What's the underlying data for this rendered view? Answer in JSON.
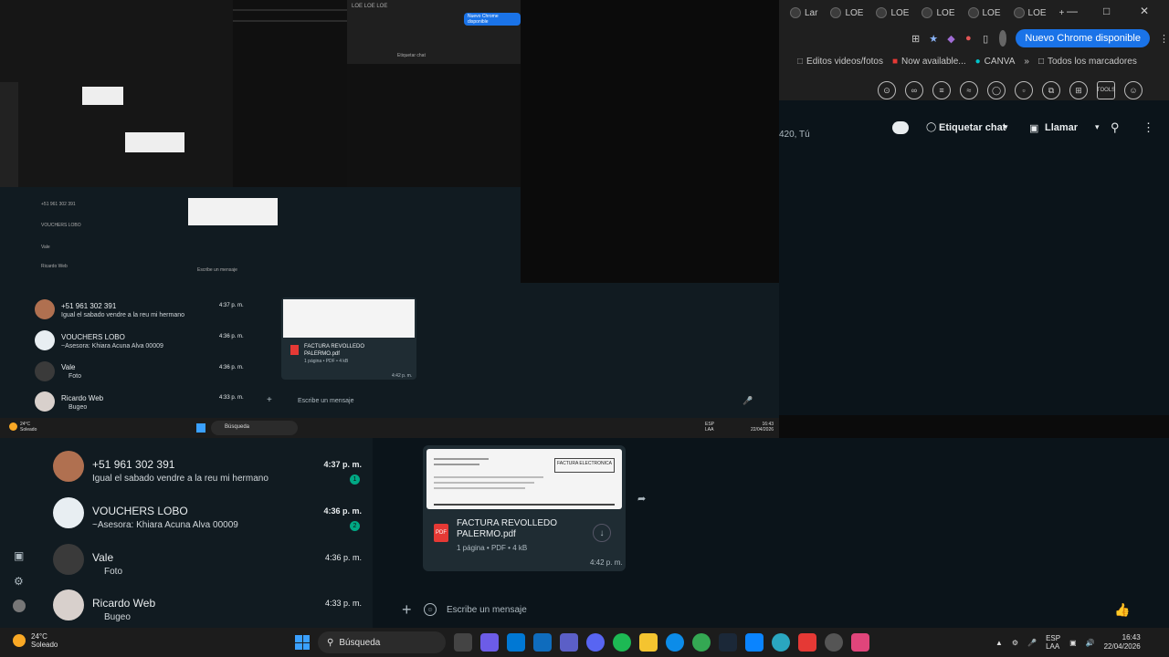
{
  "chrome": {
    "tabs": [
      "Lar",
      "LOE",
      "LOE",
      "LOE",
      "LOE",
      "LOE"
    ],
    "new_chrome_label": "Nuevo Chrome disponible",
    "bookmarks": [
      "Editos videos/fotos",
      "Now available...",
      "CANVA"
    ],
    "all_bookmarks": "Todos los marcadores",
    "ext_tools_label": "TOOLS"
  },
  "chat_header": {
    "tag_label": "Etiquetar chat",
    "call_label": "Llamar",
    "sub": "420, Tú"
  },
  "mid": {
    "chat_items": [
      {
        "name": "+51 961 302 391",
        "msg": "Igual el sabado vendre a la reu mi hermano",
        "time": "4:37 p. m."
      },
      {
        "name": "VOUCHERS LOBO",
        "msg": "~Asesora: Khiara Acuna Alva 00009",
        "time": "4:36 p. m."
      },
      {
        "name": "Vale",
        "msg": "Foto",
        "time": "4:36 p. m."
      },
      {
        "name": "Ricardo Web",
        "msg": "Bugeo",
        "time": "4:33 p. m."
      }
    ],
    "doc_name": "FACTURA REVOLLEDO PALERMO.pdf",
    "doc_meta": "1 página • PDF • 4 kB",
    "doc_time": "4:42 p. m.",
    "composer": "Escribe un mensaje",
    "taskbar_search": "Búsqueda",
    "weather_temp": "24°C",
    "weather_desc": "Soleado",
    "lang": "ESP",
    "lang2": "LAA",
    "time": "16:43",
    "date": "22/04/2026"
  },
  "main": {
    "chat_items": [
      {
        "name": "+51 961 302 391",
        "msg": "Igual el sabado vendre a la reu mi hermano",
        "time": "4:37 p. m.",
        "badge": "1",
        "avatar_color": "#b07050"
      },
      {
        "name": "VOUCHERS LOBO",
        "msg": "~Asesora: Khiara Acuna Alva 00009",
        "time": "4:36 p. m.",
        "badge": "2",
        "avatar_color": "#e8eef2"
      },
      {
        "name": "Vale",
        "msg": "Foto",
        "time": "4:36 p. m.",
        "badge": "",
        "avatar_color": "#3a3a3a"
      },
      {
        "name": "Ricardo Web",
        "msg": "Bugeo",
        "time": "4:33 p. m.",
        "badge": "",
        "avatar_color": "#d8d0cc"
      }
    ],
    "doc_name": "FACTURA REVOLLEDO PALERMO.pdf",
    "doc_meta": "1 página • PDF • 4 kB",
    "doc_time": "4:42 p. m.",
    "doc_header_title": "FACTURA ELECTRONICA",
    "composer": "Escribe un mensaje"
  },
  "taskbar": {
    "weather_temp": "24°C",
    "weather_desc": "Soleado",
    "search": "Búsqueda",
    "lang": "ESP",
    "lang2": "LAA",
    "time": "16:43",
    "date": "22/04/2026"
  }
}
